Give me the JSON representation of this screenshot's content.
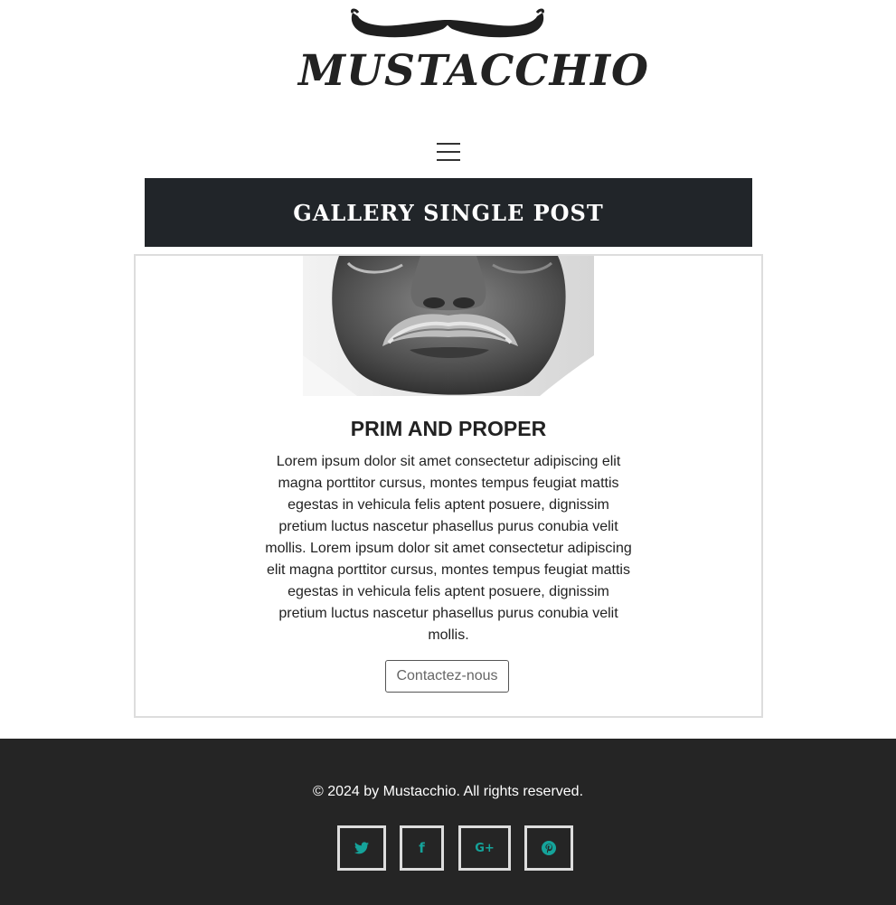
{
  "header": {
    "logo_text": "MUSTACCHIO",
    "menu_icon": "hamburger-menu-icon"
  },
  "title_band": {
    "title": "GALLERY SINGLE POST"
  },
  "post": {
    "image_alt": "black-and-white close-up of a man's mustache",
    "title": "PRIM AND PROPER",
    "body": "Lorem ipsum dolor sit amet consectetur adipiscing elit magna porttitor cursus, montes tempus feugiat mattis egestas in vehicula felis aptent posuere, dignissim pretium luctus nascetur phasellus purus conubia velit mollis. Lorem ipsum dolor sit amet consectetur adipiscing elit magna porttitor cursus, montes tempus feugiat mattis egestas in vehicula felis aptent posuere, dignissim pretium luctus nascetur phasellus purus conubia velit mollis.",
    "button_label": "Contactez-nous"
  },
  "footer": {
    "copyright": "© 2024 by Mustacchio. All rights reserved.",
    "social": [
      {
        "name": "twitter-icon",
        "glyph": "🐦"
      },
      {
        "name": "facebook-icon",
        "glyph": "f"
      },
      {
        "name": "google-plus-icon",
        "glyph": "G+"
      },
      {
        "name": "pinterest-icon",
        "glyph": "P"
      }
    ]
  },
  "colors": {
    "title_band_bg": "#212529",
    "footer_bg": "#252525",
    "social_icon": "#15a39a"
  }
}
